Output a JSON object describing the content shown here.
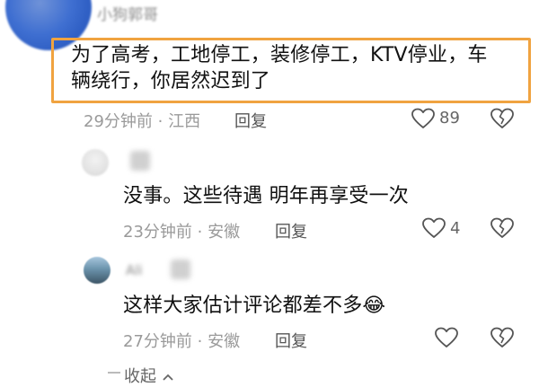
{
  "comments": [
    {
      "username": "小狗郭哥",
      "text_line1": "为了高考，工地停工，装修停工，KTV停业，车",
      "text_line2": "辆绕行，你居然迟到了",
      "time": "29分钟前",
      "location": "江西",
      "reply_label": "回复",
      "likes": "89"
    },
    {
      "text": "没事。这些待遇 明年再享受一次",
      "time": "23分钟前",
      "location": "安徽",
      "reply_label": "回复",
      "likes": "4"
    },
    {
      "username": "Ali",
      "text": "这样大家估计评论都差不多",
      "emoji": "😂",
      "time": "27分钟前",
      "location": "安徽",
      "reply_label": "回复",
      "likes": ""
    }
  ],
  "collapse": {
    "label": "收起"
  },
  "meta_separator": "·",
  "colors": {
    "highlight_border": "#f0a340",
    "meta_text": "#9a9a9a"
  },
  "icons": {
    "like": "heart-outline-icon",
    "dislike": "broken-heart-icon",
    "collapse": "chevron-up-icon"
  }
}
